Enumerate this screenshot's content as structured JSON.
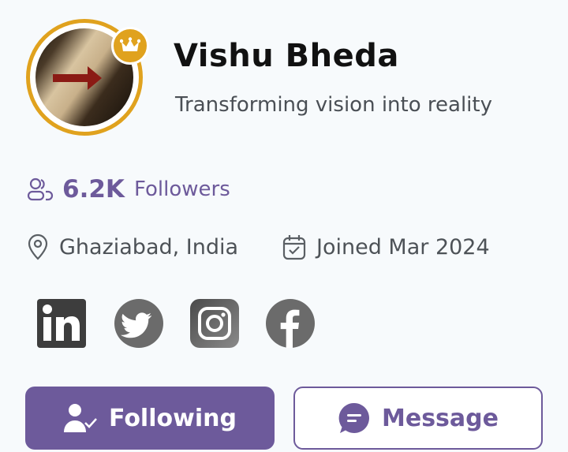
{
  "profile": {
    "name": "Vishu Bheda",
    "tagline": "Transforming vision into reality",
    "followers_count": "6.2K",
    "followers_label": "Followers",
    "location": "Ghaziabad, India",
    "joined": "Joined Mar 2024"
  },
  "badges": {
    "crown_icon": "crown-icon",
    "crown_color": "#e0a21e"
  },
  "socials": [
    {
      "icon": "linkedin-icon"
    },
    {
      "icon": "twitter-icon"
    },
    {
      "icon": "instagram-icon"
    },
    {
      "icon": "facebook-icon"
    }
  ],
  "actions": {
    "following_label": "Following",
    "message_label": "Message"
  },
  "colors": {
    "accent": "#6d5a9b",
    "ring": "#e0a21e",
    "social_gray": "#6b6b6b"
  }
}
